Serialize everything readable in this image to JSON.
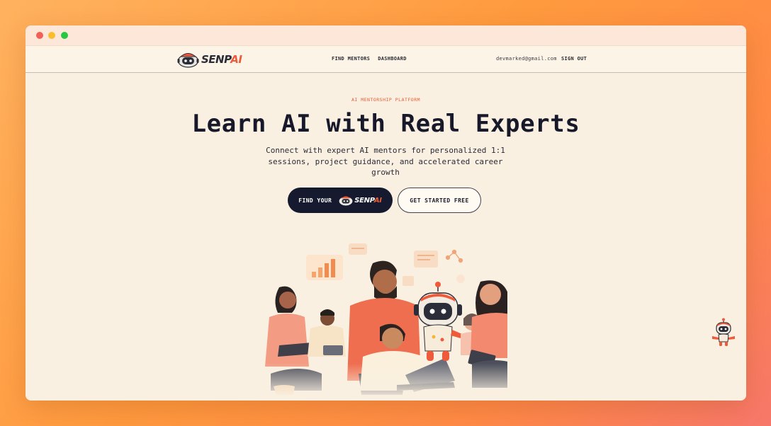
{
  "nav": {
    "logo": {
      "prefix": "SENP",
      "accent": "AI"
    },
    "links": [
      "FIND MENTORS",
      "DASHBOARD"
    ],
    "user_email": "devmarked@gmail.com",
    "sign_out_label": "SIGN OUT"
  },
  "hero": {
    "eyebrow": "AI MENTORSHIP PLATFORM",
    "headline": "Learn AI with Real Experts",
    "subhead": "Connect with expert AI mentors for personalized 1:1 sessions, project guidance, and accelerated career growth",
    "cta_primary": {
      "label": "FIND YOUR",
      "brand_prefix": "SENP",
      "brand_accent": "AI"
    },
    "cta_secondary_label": "GET STARTED FREE"
  },
  "colors": {
    "accent": "#ef5b3a",
    "primary_dark": "#151a2e",
    "page_background": "#faf0e1",
    "frame_gradient_start": "#ffb25e",
    "frame_gradient_end": "#f7776a"
  },
  "icons": {
    "logo": "robot-head-icon",
    "floating_assistant": "robot-assistant-icon"
  }
}
